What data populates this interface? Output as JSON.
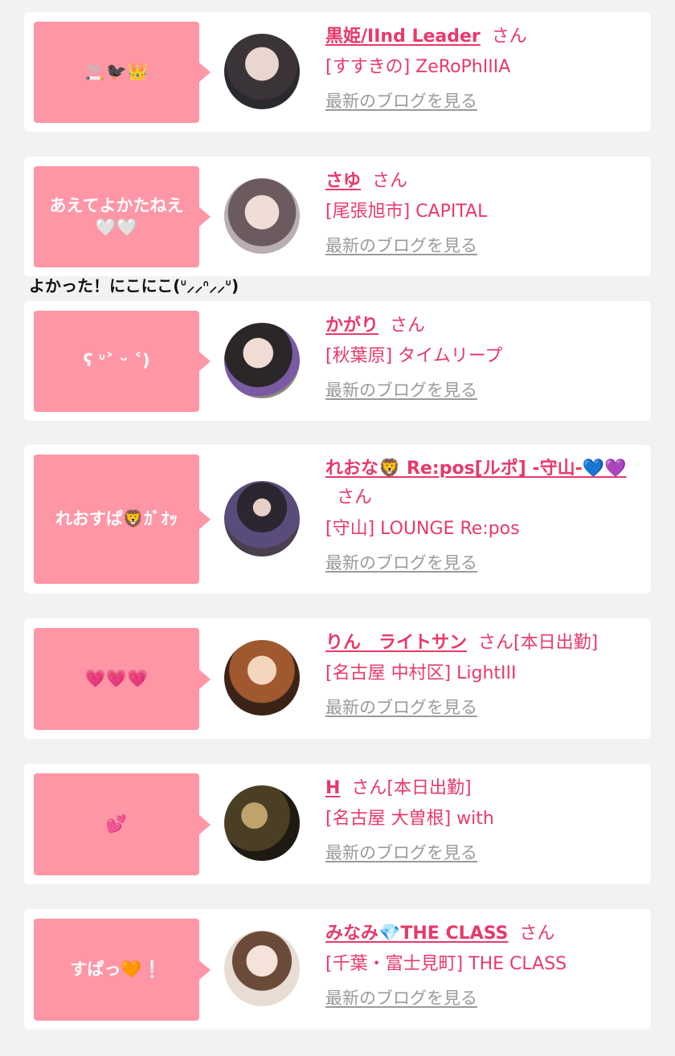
{
  "colors": {
    "page_bg": "#f2f2f2",
    "card_bg": "#ffffff",
    "bubble_bg": "#ff96a6",
    "accent_pink": "#e8396a",
    "link_gray": "#9a9a9a"
  },
  "overflow_comment": "よかった！にこにこ(ᐡ⸝⸝ᐢ⸝⸝ᐡ)",
  "cards": [
    {
      "comment": "🚬🐦‍⬛👑",
      "name": "黒姫/IInd Leader",
      "san": "さん",
      "shop": "[すすきの] ZeRoPhIIIA",
      "blog": "最新のブログを見る"
    },
    {
      "comment": "あえてよかたねえ🤍🤍",
      "name": "さゆ",
      "san": "さん",
      "shop": "[尾張旭市] CAPITAL",
      "blog": "最新のブログを見る"
    },
    {
      "comment": "ʕ ᐡ˃ ᵕ ˂)",
      "name": "かがり",
      "san": "さん",
      "shop": "[秋葉原] タイムリープ",
      "blog": "最新のブログを見る"
    },
    {
      "comment": "れおすぱ🦁ｶﾞｵｯ",
      "name": "れおな🦁 Re:pos[ルポ] -守山-💙💜",
      "san": "さん",
      "shop": "[守山] LOUNGE Re:pos",
      "blog": "最新のブログを見る"
    },
    {
      "comment": "💗💗💗",
      "name": "りん　ライトサン",
      "san": "さん[本日出勤]",
      "shop": "[名古屋 中村区] LightIII",
      "blog": "最新のブログを見る"
    },
    {
      "comment": "💕",
      "name": "H",
      "san": "さん[本日出勤]",
      "shop": "[名古屋 大曽根] with",
      "blog": "最新のブログを見る"
    },
    {
      "comment": "すぱっ🧡❕",
      "name": "みなみ💎THE CLASS",
      "san": "さん",
      "shop": "[千葉・富士見町] THE CLASS",
      "blog": "最新のブログを見る"
    }
  ]
}
